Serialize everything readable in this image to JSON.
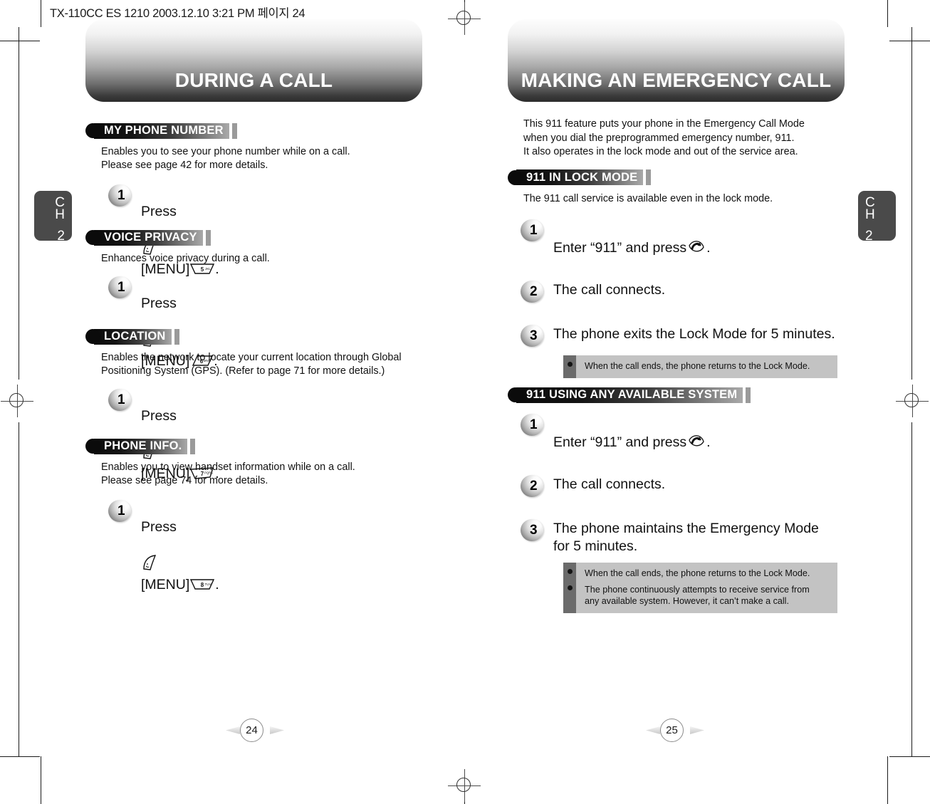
{
  "document": {
    "file_info": "TX-110CC ES 1210  2003.12.10 3:21 PM  페이지 24"
  },
  "left_page": {
    "title": "DURING A CALL",
    "chapter_tab": {
      "c": "C",
      "h": "H",
      "number": "2"
    },
    "page_number": "24",
    "sections": [
      {
        "heading": "MY PHONE NUMBER",
        "body": "Enables you to see your phone number while on a call.\nPlease see page 42 for more details.",
        "steps": [
          {
            "number": "1",
            "prefix": "Press",
            "key_menu": "[MENU]",
            "key_digit": "5",
            "key_letters": "JKL",
            "suffix": "."
          }
        ]
      },
      {
        "heading": "VOICE PRIVACY",
        "body": "Enhances voice privacy during a call.",
        "steps": [
          {
            "number": "1",
            "prefix": "Press",
            "key_menu": "[MENU]",
            "key_digit": "6",
            "key_letters": "MNO",
            "suffix": "."
          }
        ]
      },
      {
        "heading": "LOCATION",
        "body": "Enables the network to locate your current location through Global\nPositioning System (GPS). (Refer to page 71 for more details.)",
        "steps": [
          {
            "number": "1",
            "prefix": "Press",
            "key_menu": "[MENU]",
            "key_digit": "7",
            "key_letters": "PQRS",
            "suffix": "."
          }
        ]
      },
      {
        "heading": "PHONE INFO.",
        "body": "Enables you to view handset information while on a call.\nPlease see page 74 for more details.",
        "steps": [
          {
            "number": "1",
            "prefix": "Press",
            "key_menu": "[MENU]",
            "key_digit": "8",
            "key_letters": "TUV",
            "suffix": "."
          }
        ]
      }
    ]
  },
  "right_page": {
    "title": "MAKING AN EMERGENCY CALL",
    "chapter_tab": {
      "c": "C",
      "h": "H",
      "number": "2"
    },
    "page_number": "25",
    "intro": "This 911 feature puts your phone in the Emergency Call Mode\nwhen you dial the preprogrammed emergency number, 911.\nIt also operates in the lock mode and out of the service area.",
    "sections": [
      {
        "heading": "911 IN LOCK MODE",
        "body": "The 911 call service is available even in the lock mode.",
        "steps": [
          {
            "number": "1",
            "text_before": "Enter “911” and press",
            "has_send_key": true,
            "text_after": "."
          },
          {
            "number": "2",
            "text": "The call connects."
          },
          {
            "number": "3",
            "text": "The phone exits the Lock Mode for 5 minutes."
          }
        ],
        "notes": [
          "When the call ends, the phone returns to the Lock Mode."
        ]
      },
      {
        "heading": "911 USING ANY AVAILABLE SYSTEM",
        "body": "",
        "steps": [
          {
            "number": "1",
            "text_before": "Enter “911” and press",
            "has_send_key": true,
            "text_after": "."
          },
          {
            "number": "2",
            "text": "The call connects."
          },
          {
            "number": "3",
            "text": "The phone maintains the Emergency Mode\nfor 5 minutes."
          }
        ],
        "notes": [
          "When the call ends, the phone returns to the Lock Mode.",
          "The phone continuously attempts to receive service from\nany available system.  However, it can’t make a call."
        ]
      }
    ]
  },
  "colors": {
    "banner_dark": "#2c2c2c",
    "tab_gray": "#4a4a4a",
    "note_body": "#c3c3c3",
    "note_bullet_col": "#6b6b6b",
    "text": "#111111"
  }
}
